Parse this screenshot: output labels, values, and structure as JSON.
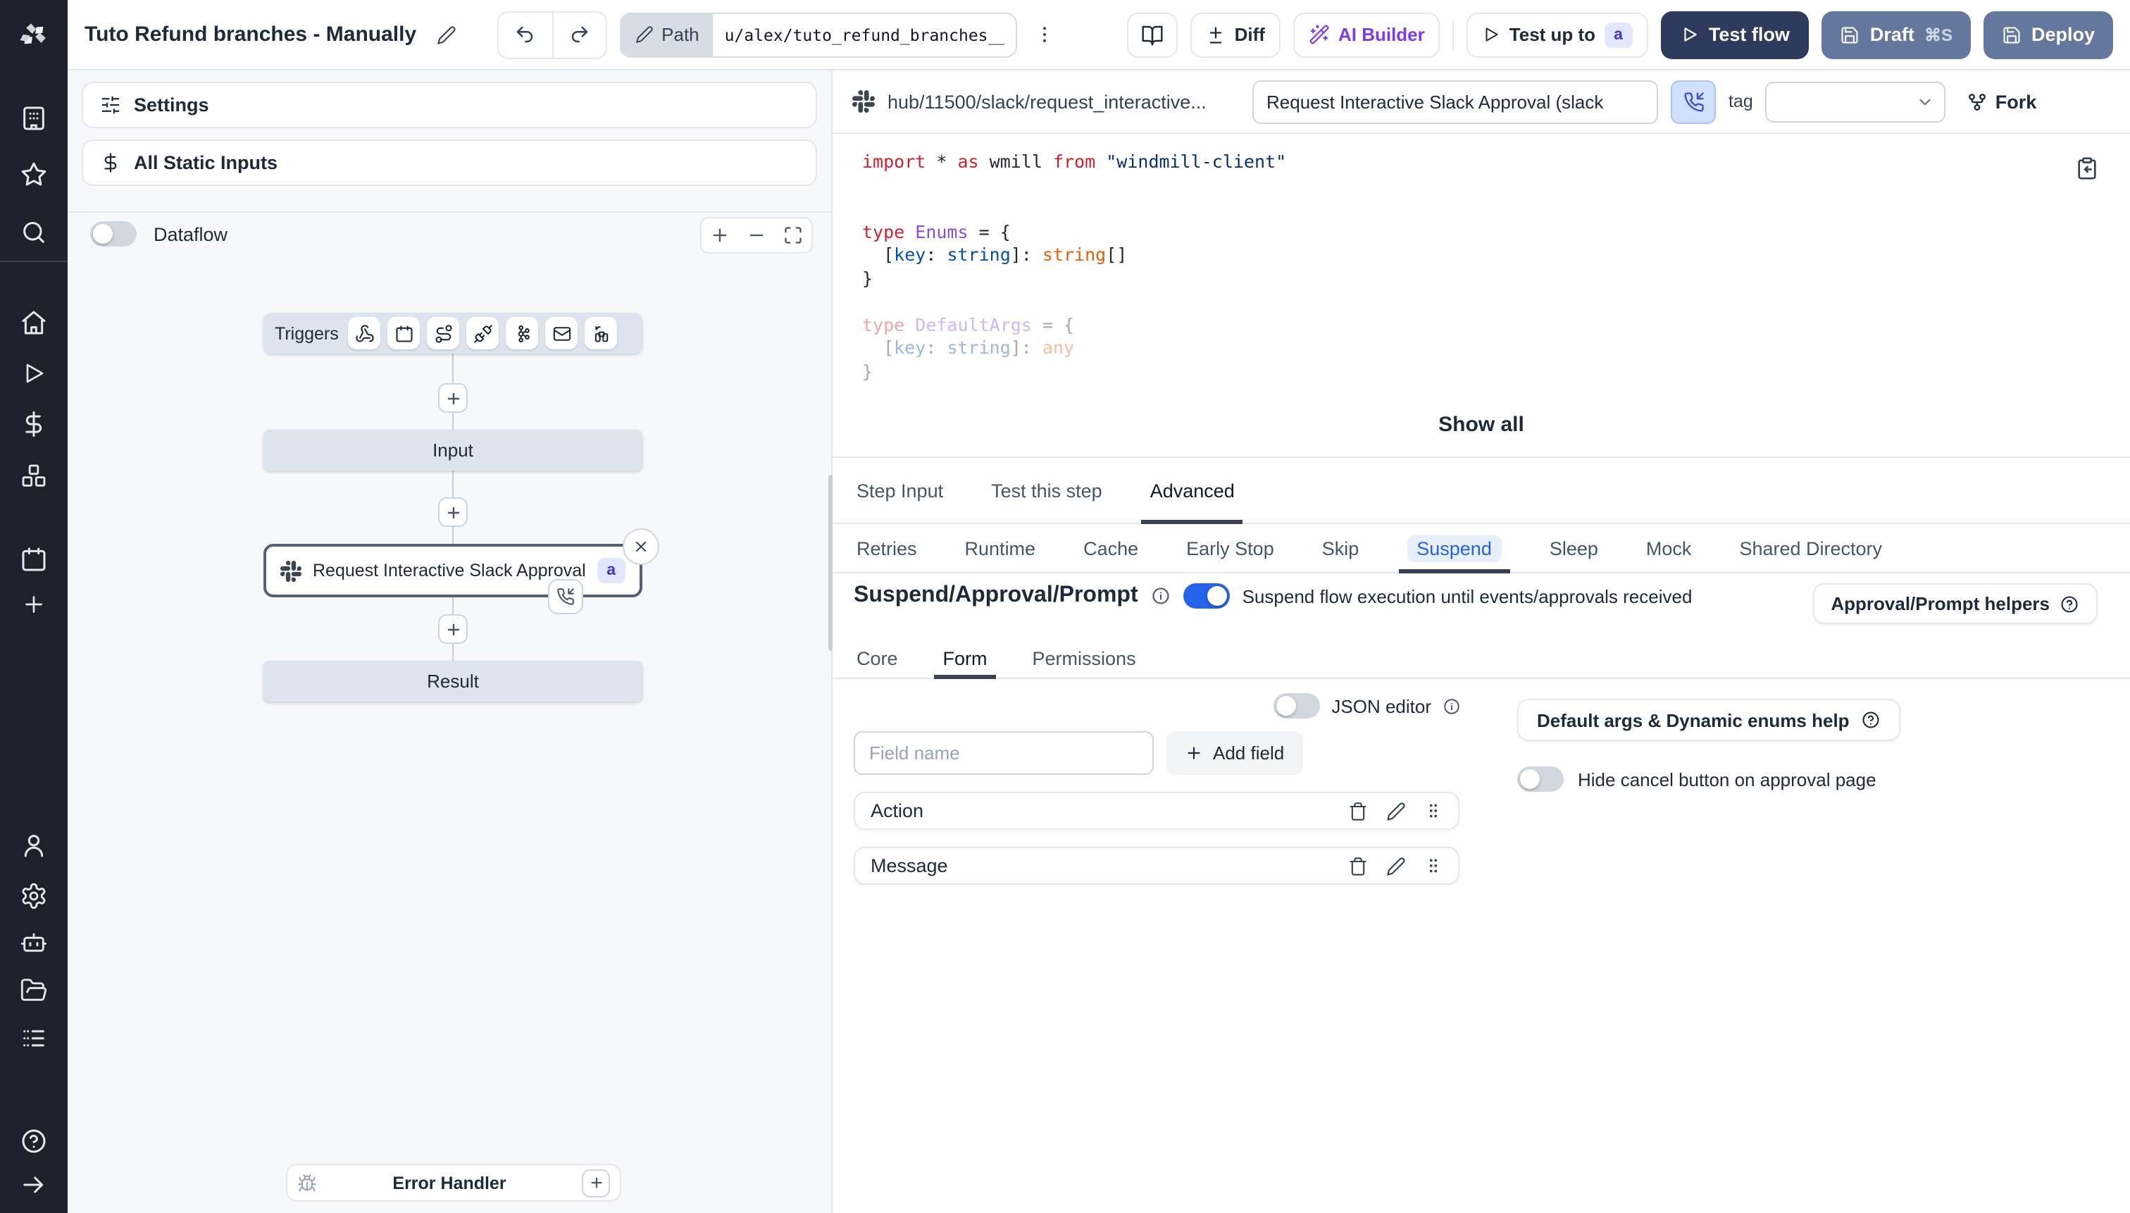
{
  "topbar": {
    "title": "Tuto Refund branches - Manually",
    "path_label": "Path",
    "path_value": "u/alex/tuto_refund_branches__",
    "diff_label": "Diff",
    "ai_builder_label": "AI Builder",
    "test_up_to_label": "Test up to",
    "test_up_to_badge": "a",
    "test_flow_label": "Test flow",
    "draft_label": "Draft",
    "draft_shortcut": "⌘S",
    "deploy_label": "Deploy"
  },
  "flow": {
    "settings_label": "Settings",
    "static_inputs_label": "All Static Inputs",
    "dataflow_label": "Dataflow",
    "triggers_label": "Triggers",
    "input_label": "Input",
    "node_label": "Request Interactive Slack Approval (...",
    "node_badge": "a",
    "result_label": "Result",
    "error_handler_label": "Error Handler"
  },
  "right": {
    "header": {
      "hub_path": "hub/11500/slack/request_interactive...",
      "name_value": "Request Interactive Slack Approval (slack",
      "tag_label": "tag",
      "fork_label": "Fork"
    },
    "code": {
      "show_all_label": "Show all",
      "lines": [
        {
          "dim": false,
          "tokens": [
            [
              "k",
              "import"
            ],
            [
              "p",
              " * "
            ],
            [
              "k",
              "as"
            ],
            [
              "p",
              " wmill "
            ],
            [
              "k",
              "from"
            ],
            [
              "p",
              " "
            ],
            [
              "s",
              "\"windmill-client\""
            ]
          ]
        },
        {
          "dim": false,
          "tokens": []
        },
        {
          "dim": false,
          "tokens": []
        },
        {
          "dim": false,
          "tokens": [
            [
              "k",
              "type"
            ],
            [
              "p",
              " "
            ],
            [
              "e",
              "Enums"
            ],
            [
              "p",
              " = {"
            ]
          ]
        },
        {
          "dim": false,
          "tokens": [
            [
              "p",
              "  ["
            ],
            [
              "b",
              "key"
            ],
            [
              "p",
              ": "
            ],
            [
              "b",
              "string"
            ],
            [
              "p",
              "]: "
            ],
            [
              "o",
              "string"
            ],
            [
              "p",
              "[]"
            ]
          ]
        },
        {
          "dim": false,
          "tokens": [
            [
              "p",
              "}"
            ]
          ]
        },
        {
          "dim": false,
          "tokens": []
        },
        {
          "dim": true,
          "tokens": [
            [
              "k",
              "type"
            ],
            [
              "p",
              " "
            ],
            [
              "e",
              "DefaultArgs"
            ],
            [
              "p",
              " = {"
            ]
          ]
        },
        {
          "dim": true,
          "tokens": [
            [
              "p",
              "  ["
            ],
            [
              "b",
              "key"
            ],
            [
              "p",
              ": "
            ],
            [
              "b",
              "string"
            ],
            [
              "p",
              "]: "
            ],
            [
              "o",
              "any"
            ]
          ]
        },
        {
          "dim": true,
          "tokens": [
            [
              "p",
              "}"
            ]
          ]
        }
      ]
    },
    "tabs": [
      "Step Input",
      "Test this step",
      "Advanced"
    ],
    "active_tab": "Advanced",
    "subtabs": [
      "Retries",
      "Runtime",
      "Cache",
      "Early Stop",
      "Skip",
      "Suspend",
      "Sleep",
      "Mock",
      "Shared Directory"
    ],
    "active_subtab": "Suspend",
    "suspend": {
      "heading": "Suspend/Approval/Prompt",
      "toggle_desc": "Suspend flow execution until events/approvals received",
      "helpers_label": "Approval/Prompt helpers",
      "tabs": [
        "Core",
        "Form",
        "Permissions"
      ],
      "active_tab": "Form",
      "form": {
        "json_editor_label": "JSON editor",
        "field_placeholder": "Field name",
        "add_field_label": "Add field",
        "fields": [
          "Action",
          "Message"
        ],
        "default_args_help_label": "Default args & Dynamic enums help",
        "hide_cancel_label": "Hide cancel button on approval page"
      }
    }
  },
  "colors": {
    "sidebar_bg": "#1d212b",
    "accent_blue": "#2563eb",
    "dark_button": "#2f3b5d",
    "steel_button": "#64779c",
    "ai_purple": "#7c3aed",
    "badge_bg": "#e0e7ff",
    "badge_text": "#4338ca",
    "canvas_bg": "#f7f8fa",
    "node_fill": "#dee4ee"
  }
}
